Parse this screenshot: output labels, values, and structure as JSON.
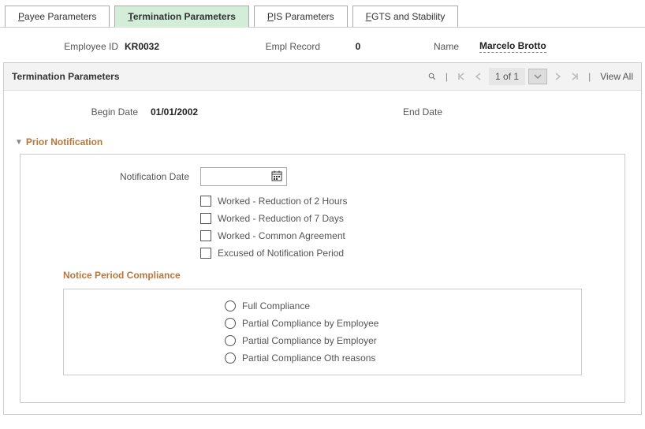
{
  "tabs": {
    "payee": {
      "pre": "P",
      "rest": "ayee Parameters"
    },
    "termination": {
      "pre": "T",
      "rest": "ermination Parameters"
    },
    "pis": {
      "pre": "P",
      "rest": "IS Parameters"
    },
    "fgts": {
      "pre": "F",
      "rest": "GTS and Stability"
    }
  },
  "info": {
    "emp_id_label": "Employee ID",
    "emp_id": "KR0032",
    "empl_record_label": "Empl Record",
    "empl_record": "0",
    "name_label": "Name",
    "name": "Marcelo Brotto"
  },
  "panel": {
    "title": "Termination Parameters",
    "pager": "1 of 1",
    "view_all": "View All"
  },
  "dates": {
    "begin_label": "Begin Date",
    "begin_value": "01/01/2002",
    "end_label": "End Date",
    "end_value": ""
  },
  "prior_notification": {
    "heading": "Prior Notification",
    "notification_date_label": "Notification Date",
    "notification_date_value": "",
    "checks": [
      "Worked - Reduction of 2 Hours",
      "Worked - Reduction of 7 Days",
      "Worked - Common Agreement",
      "Excused of Notification Period"
    ]
  },
  "notice_compliance": {
    "heading": "Notice Period Compliance",
    "options": [
      "Full Compliance",
      "Partial Compliance by Employee",
      "Partial Compliance by Employer",
      "Partial Compliance Oth reasons"
    ]
  }
}
